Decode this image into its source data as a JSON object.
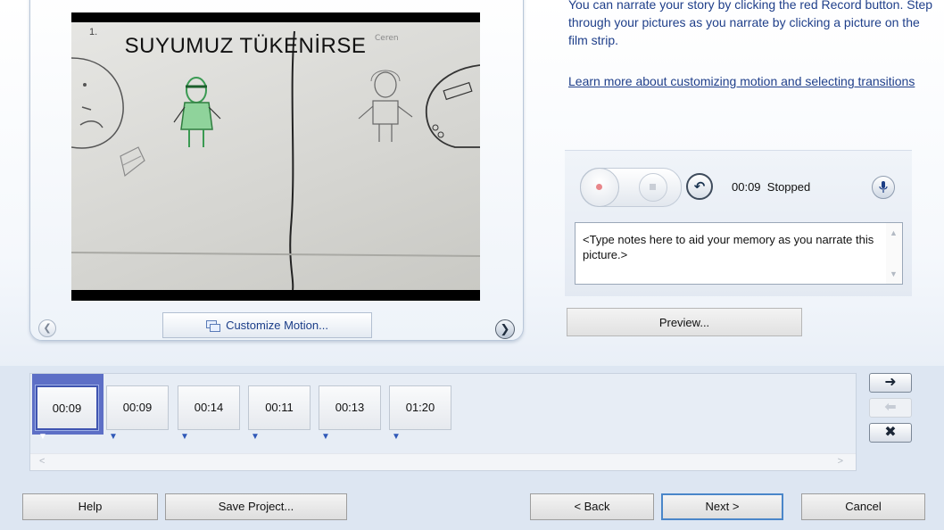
{
  "instructions": {
    "text": "You can narrate your story by clicking the red Record button. Step through your pictures as you narrate by clicking a picture on the film strip.",
    "learn_more_link": "Learn more about customizing motion and selecting transitions"
  },
  "preview": {
    "picture_title": "SUYUMUZ TÜKENİRSE",
    "picture_number": "1.",
    "customize_motion_label": "Customize Motion..."
  },
  "recorder": {
    "time": "00:09",
    "status": "Stopped",
    "notes_placeholder": "<Type notes here to aid your memory as you narrate this picture.>",
    "preview_button_label": "Preview..."
  },
  "film_strip": {
    "thumbnails": [
      {
        "duration": "00:09",
        "selected": true
      },
      {
        "duration": "00:09",
        "selected": false
      },
      {
        "duration": "00:14",
        "selected": false
      },
      {
        "duration": "00:11",
        "selected": false
      },
      {
        "duration": "00:13",
        "selected": false
      },
      {
        "duration": "01:20",
        "selected": false
      }
    ]
  },
  "side_buttons": {
    "next_icon": "arrow-right-icon",
    "prev_icon": "arrow-left-icon",
    "remove_icon": "close-icon"
  },
  "footer": {
    "help": "Help",
    "save_project": "Save Project...",
    "back": "< Back",
    "next": "Next >",
    "cancel": "Cancel"
  }
}
